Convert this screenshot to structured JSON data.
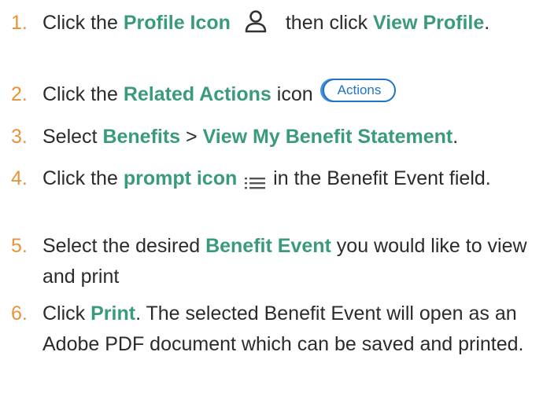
{
  "steps": [
    {
      "number": "1.",
      "parts": [
        "Click the ",
        "Profile Icon",
        " then click ",
        "View Profile",
        "."
      ],
      "icon": "person-outline-icon"
    },
    {
      "number": "2.",
      "parts": [
        "Click the ",
        "Related Actions",
        " icon"
      ],
      "button_label": "Actions"
    },
    {
      "number": "3.",
      "parts": [
        "Select ",
        "Benefits",
        " > ",
        "View My Benefit Statement",
        "."
      ]
    },
    {
      "number": "4.",
      "parts": [
        "Click the ",
        "prompt icon",
        " in the Benefit Event field."
      ],
      "icon": "list-prompt-icon"
    },
    {
      "number": "5.",
      "parts": [
        "Select the desired ",
        "Benefit Event",
        " you would like to view and print"
      ]
    },
    {
      "number": "6.",
      "parts": [
        "Click ",
        "Print",
        ". The selected Benefit Event will open as an Adobe PDF document which can be saved and printed."
      ]
    }
  ],
  "colors": {
    "number": "#e8923a",
    "keyword": "#3a9a7c",
    "body_text": "#2b2b2b",
    "actions_button": "#1f73c9"
  }
}
